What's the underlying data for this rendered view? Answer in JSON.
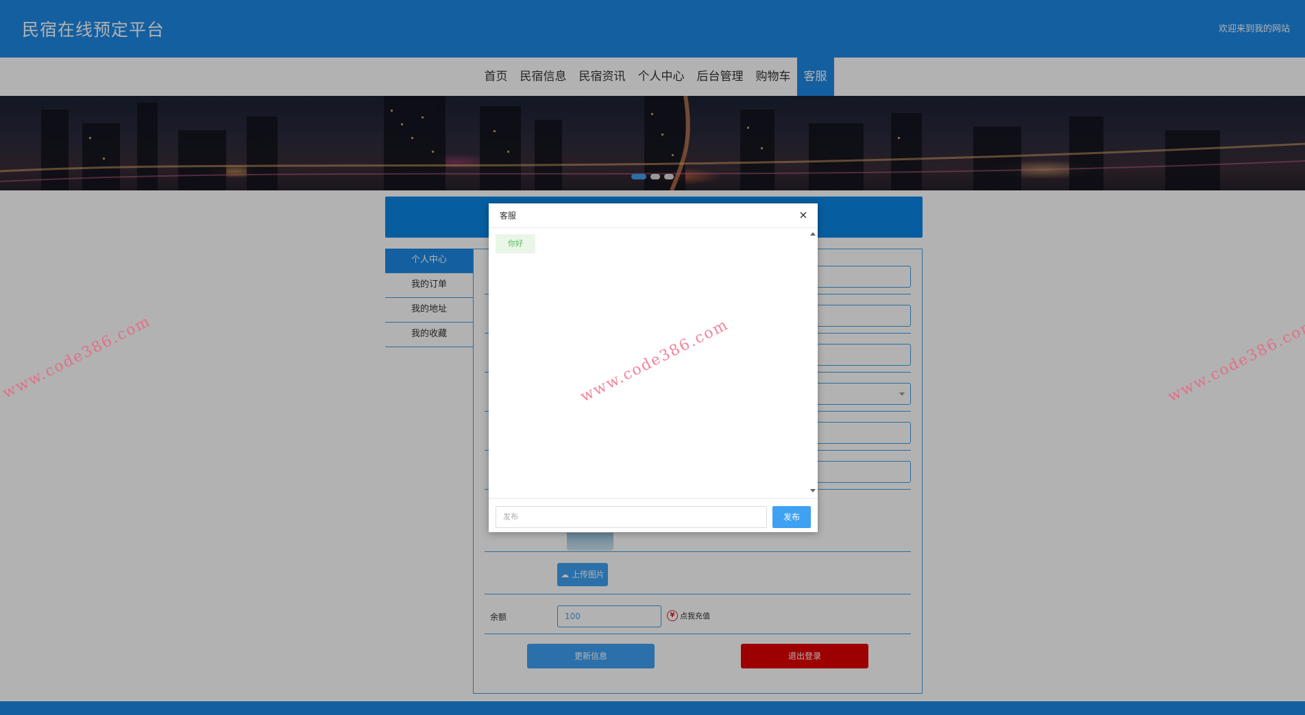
{
  "header": {
    "site_title": "民宿在线预定平台",
    "welcome": "欢迎来到我的网站"
  },
  "nav": {
    "items": [
      {
        "label": "首页"
      },
      {
        "label": "民宿信息"
      },
      {
        "label": "民宿资讯"
      },
      {
        "label": "个人中心"
      },
      {
        "label": "后台管理"
      },
      {
        "label": "购物车"
      },
      {
        "label": "客服"
      }
    ],
    "active": "客服"
  },
  "side_menu": {
    "items": [
      {
        "label": "个人中心"
      },
      {
        "label": "我的订单"
      },
      {
        "label": "我的地址"
      },
      {
        "label": "我的收藏"
      }
    ],
    "active": "个人中心"
  },
  "form": {
    "upload_label": "上传图片",
    "balance_label": "余额",
    "balance_value": "100",
    "recharge_label": "点我充值",
    "update_label": "更新信息",
    "logout_label": "退出登录"
  },
  "modal": {
    "title": "客服",
    "messages": [
      {
        "text": "你好"
      }
    ],
    "input_placeholder": "发布",
    "send_label": "发布"
  },
  "watermark": {
    "text": "www.code386.com"
  },
  "colors": {
    "primary": "#1e88e5",
    "accent_blue": "#3ea1f2",
    "danger": "#e00000",
    "watermark": "#f05a7a",
    "chat_bubble_text": "#5cb85c"
  },
  "icons": {
    "close": "close-icon",
    "upload": "cloud-upload-icon",
    "recharge": "yen-icon"
  }
}
